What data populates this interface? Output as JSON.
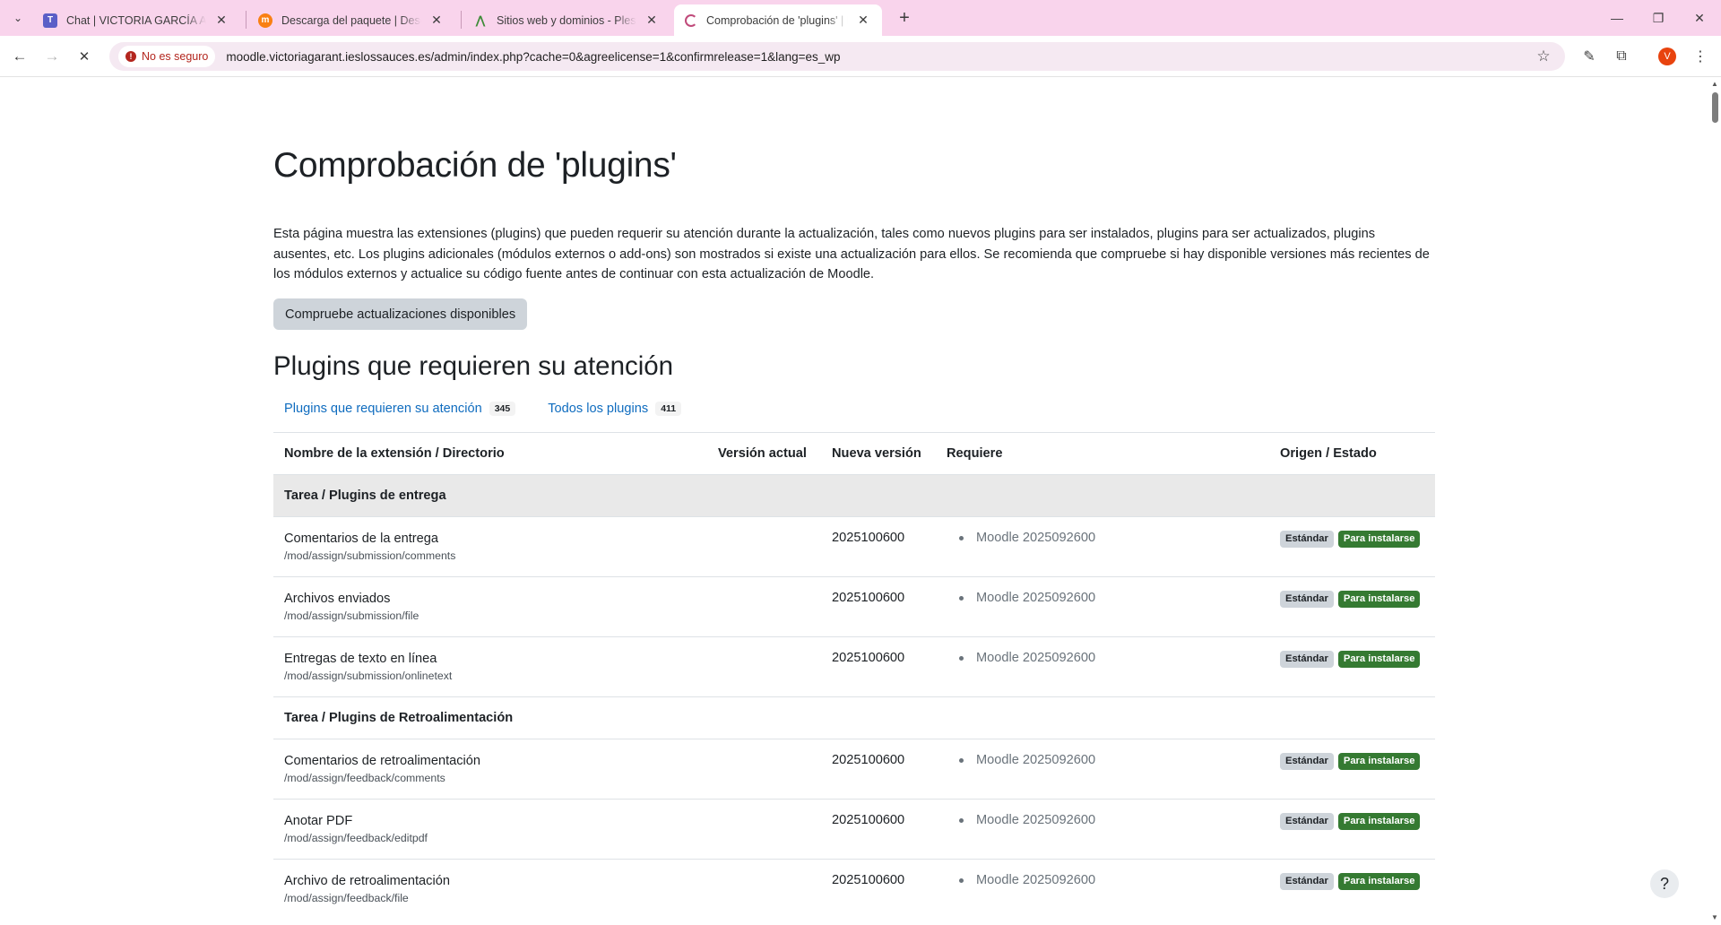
{
  "browser": {
    "tabs": [
      {
        "title": "Chat | VICTORIA GARCÍA ANTÓN",
        "favicon": "teams-icon",
        "active": false
      },
      {
        "title": "Descarga del paquete | Descarga",
        "favicon": "moodle-icon",
        "active": false
      },
      {
        "title": "Sitios web y dominios - Plesk - ...",
        "favicon": "plesk-icon",
        "active": false
      },
      {
        "title": "Comprobación de 'plugins' | Mo",
        "favicon": "moodle-loading-icon",
        "active": true
      }
    ],
    "security_label": "No es seguro",
    "url": "moodle.victoriagarant.ieslossauces.es/admin/index.php?cache=0&agreelicense=1&confirmrelease=1&lang=es_wp",
    "profile_initial": "V"
  },
  "page": {
    "title": "Comprobación de 'plugins'",
    "intro": "Esta página muestra las extensiones (plugins) que pueden requerir su atención durante la actualización, tales como nuevos plugins para ser instalados, plugins para ser actualizados, plugins ausentes, etc. Los plugins adicionales (módulos externos o add-ons) son mostrados si existe una actualización para ellos. Se recomienda que compruebe si hay disponible versiones más recientes de los módulos externos y actualice su código fuente antes de continuar con esta actualización de Moodle.",
    "check_button": "Compruebe actualizaciones disponibles",
    "section_title": "Plugins que requieren su atención",
    "filters": [
      {
        "label": "Plugins que requieren su atención",
        "count": "345"
      },
      {
        "label": "Todos los plugins",
        "count": "411"
      }
    ],
    "table": {
      "headers": {
        "name": "Nombre de la extensión / Directorio",
        "current": "Versión actual",
        "new": "Nueva versión",
        "requires": "Requiere",
        "status": "Origen / Estado"
      },
      "groups": [
        {
          "name": "Tarea / Plugins de entrega",
          "rows": [
            {
              "name": "Comentarios de la entrega",
              "dir": "/mod/assign/submission/comments",
              "current": "",
              "new": "2025100600",
              "requires": "Moodle 2025092600",
              "source": "Estándar",
              "status": "Para instalarse"
            },
            {
              "name": "Archivos enviados",
              "dir": "/mod/assign/submission/file",
              "current": "",
              "new": "2025100600",
              "requires": "Moodle 2025092600",
              "source": "Estándar",
              "status": "Para instalarse"
            },
            {
              "name": "Entregas de texto en línea",
              "dir": "/mod/assign/submission/onlinetext",
              "current": "",
              "new": "2025100600",
              "requires": "Moodle 2025092600",
              "source": "Estándar",
              "status": "Para instalarse"
            }
          ]
        },
        {
          "name": "Tarea / Plugins de Retroalimentación",
          "rows": [
            {
              "name": "Comentarios de retroalimentación",
              "dir": "/mod/assign/feedback/comments",
              "current": "",
              "new": "2025100600",
              "requires": "Moodle 2025092600",
              "source": "Estándar",
              "status": "Para instalarse"
            },
            {
              "name": "Anotar PDF",
              "dir": "/mod/assign/feedback/editpdf",
              "current": "",
              "new": "2025100600",
              "requires": "Moodle 2025092600",
              "source": "Estándar",
              "status": "Para instalarse"
            },
            {
              "name": "Archivo de retroalimentación",
              "dir": "/mod/assign/feedback/file",
              "current": "",
              "new": "2025100600",
              "requires": "Moodle 2025092600",
              "source": "Estándar",
              "status": "Para instalarse"
            }
          ]
        }
      ]
    },
    "help_label": "?"
  }
}
